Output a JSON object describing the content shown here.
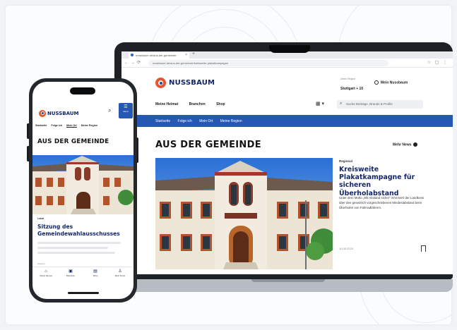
{
  "colors": {
    "brand_navy": "#13266a",
    "brand_blue": "#2557b5",
    "logo_orange": "#e8542d"
  },
  "browser": {
    "tab_title": "nussbaum.de/aus-der-gemeinde",
    "url": "nussbaum.de/aus-der-gemeinde/kreisweite-plakatkampagne"
  },
  "site": {
    "brand": "NUSSBAUM",
    "region_label": "Deine Region",
    "region_value": "Stuttgart + 10",
    "login": "Mein Nussbaum",
    "main_nav": [
      "Meine Heimat",
      "Branchen",
      "Shop"
    ],
    "search_placeholder": "Suche Beiträge, Brands & Profile",
    "sub_nav": [
      "Startseite",
      "Folge ich",
      "Mein Ort",
      "Meine Region"
    ],
    "section_title": "AUS DER GEMEINDE",
    "more_news": "Mehr News"
  },
  "article": {
    "category": "Regional",
    "headline": "Kreisweite Plakatkampagne für sicheren Überholabstand",
    "body": "Unter dem Motto „Mit Abstand sicher“ informiert der Landkreis über den gesetzlich vorgeschriebenen Mindestabstand beim Überholen von Fahrradfahrern.",
    "date": "10.05.2024"
  },
  "phone": {
    "brand": "NUSSBAUM",
    "menu_label": "Menü",
    "tabs": [
      "Startseite",
      "Folge ich",
      "Mein Ort",
      "Meine Region"
    ],
    "section_title": "AUS DER GEMEINDE",
    "article_category": "Lokal",
    "article_headline": "Sitzung des Gemeindewahlausschusses",
    "article_date": "Gestern",
    "bottom_nav": [
      {
        "label": "Meine Heimat",
        "icon": "home-icon"
      },
      {
        "label": "Branchen",
        "icon": "briefcase-icon"
      },
      {
        "label": "Shop",
        "icon": "shop-icon"
      },
      {
        "label": "Mein Konto",
        "icon": "person-icon"
      }
    ]
  }
}
